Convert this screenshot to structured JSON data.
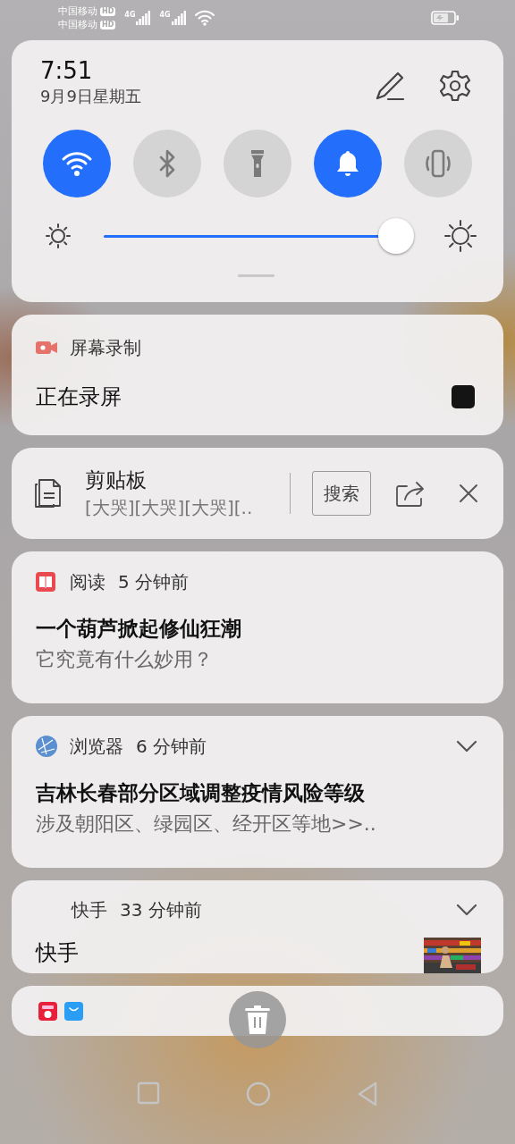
{
  "status_bar": {
    "carriers": [
      {
        "name": "中国移动",
        "badge": "HD"
      },
      {
        "name": "中国移动",
        "badge": "HD"
      }
    ],
    "signals": [
      {
        "label": "4G"
      },
      {
        "label": "4G"
      }
    ]
  },
  "quick_settings": {
    "time": "7:51",
    "date": "9月9日星期五",
    "toggles": [
      {
        "kind": "wifi",
        "on": true
      },
      {
        "kind": "bluetooth",
        "on": false
      },
      {
        "kind": "flashlight",
        "on": false
      },
      {
        "kind": "bell",
        "on": true
      },
      {
        "kind": "vibrate",
        "on": false
      }
    ],
    "brightness": {
      "level": 0.95
    }
  },
  "notifications": [
    {
      "kind": "recording",
      "app": "屏幕录制",
      "title": "正在录屏"
    },
    {
      "kind": "clipboard",
      "title": "剪贴板",
      "preview": "[大哭][大哭][大哭][..",
      "action": "搜索"
    },
    {
      "kind": "reading",
      "app": "阅读",
      "time": "5 分钟前",
      "title": "一个葫芦掀起修仙狂潮",
      "body": "它究竟有什么妙用？",
      "expandable": false
    },
    {
      "kind": "browser",
      "app": "浏览器",
      "time": "6 分钟前",
      "title": "吉林长春部分区域调整疫情风险等级",
      "body": "涉及朝阳区、绿园区、经开区等地>>..",
      "expandable": true
    },
    {
      "kind": "video",
      "app": "快手",
      "time": "33 分钟前",
      "title": "快手",
      "expandable": true
    },
    {
      "kind": "group"
    }
  ]
}
